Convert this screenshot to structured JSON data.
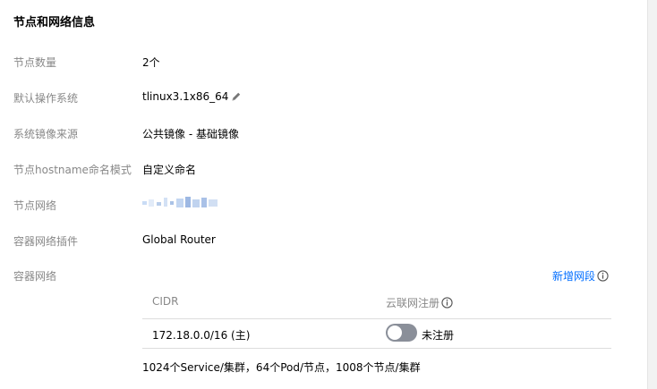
{
  "section": {
    "title": "节点和网络信息"
  },
  "rows": [
    {
      "label": "节点数量",
      "value": "2个"
    },
    {
      "label": "默认操作系统",
      "value": "tlinux3.1x86_64"
    },
    {
      "label": "系统镜像来源",
      "value": "公共镜像 - 基础镜像"
    },
    {
      "label": "节点hostname命名模式",
      "value": "自定义命名"
    },
    {
      "label": "节点网络",
      "value": ""
    },
    {
      "label": "容器网络插件",
      "value": "Global Router"
    },
    {
      "label": "容器网络",
      "value": ""
    }
  ],
  "container_network": {
    "add_link": "新增网段",
    "columns": [
      "CIDR",
      "云联网注册"
    ],
    "rows": [
      {
        "cidr": "172.18.0.0/16 (主)",
        "toggle_on": false,
        "status": "未注册"
      }
    ],
    "footnote": "1024个Service/集群，64个Pod/节点，1008个节点/集群"
  },
  "icons": {
    "edit": "pencil-icon",
    "info": "info-circle-icon"
  },
  "colors": {
    "link": "#006eff",
    "label": "#888888",
    "toggle_off": "#8a8f99"
  }
}
